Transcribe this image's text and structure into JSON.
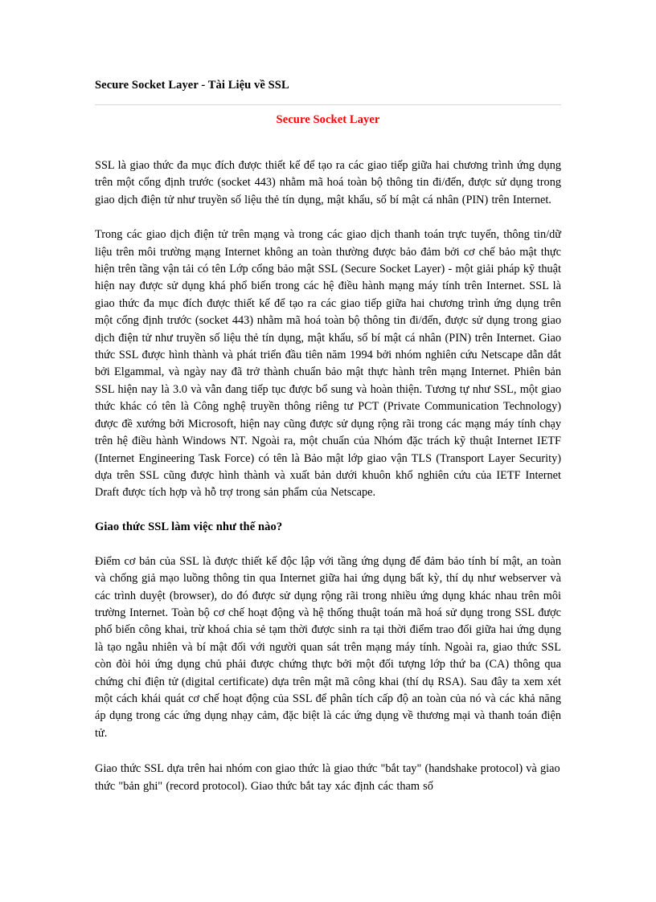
{
  "document": {
    "title": "Secure Socket Layer - Tài Liệu về SSL",
    "section_title": "Secure Socket Layer",
    "accent_color": "#ff0000",
    "text_color": "#000000",
    "rule_color": "#d9d9d9",
    "background_color": "#ffffff"
  },
  "body": {
    "paragraph_1": "SSL là giao thức đa mục đích được thiết kế để tạo ra các giao tiếp giữa hai chương trình ứng dụng trên một cổng định trước (socket 443) nhằm mã hoá toàn bộ thông tin đi/đến, được sử dụng trong giao dịch điện tử như truyền số liệu thẻ tín dụng, mật khẩu, số bí mật cá nhân (PIN) trên Internet.",
    "paragraph_2": "Trong các giao dịch điện tử trên mạng và trong các giao dịch thanh toán trực tuyến, thông tin/dữ liệu trên môi trường mạng Internet không an toàn thường được bảo đảm bởi cơ chế bảo mật thực hiện trên tầng vận tải có tên Lớp cổng bảo mật SSL (Secure Socket Layer) - một giải pháp kỹ thuật hiện nay được sử dụng khá phổ biến trong các hệ điều hành mạng máy tính trên Internet. SSL là giao thức đa mục đích được thiết kế để tạo ra các giao tiếp giữa hai chương trình ứng dụng trên một cổng định trước (socket 443) nhằm mã hoá toàn bộ thông tin đi/đến, được sử dụng trong giao dịch điện tử như truyền số liệu thẻ tín dụng, mật khẩu, số bí mật cá nhân (PIN) trên Internet. Giao thức SSL được hình thành và phát triển đầu tiên năm 1994 bởi nhóm nghiên cứu Netscape dẫn dắt bởi Elgammal, và ngày nay đã trở thành chuẩn bảo mật thực hành trên mạng Internet. Phiên bản SSL hiện nay là 3.0 và vẫn đang tiếp tục được bổ sung và hoàn thiện. Tương tự như SSL, một giao thức khác có tên là Công nghệ truyền thông riêng tư PCT (Private Communication Technology) được đề xướng bởi Microsoft, hiện nay cũng được sử dụng rộng rãi trong các mạng máy tính chạy trên hệ điều hành Windows NT. Ngoài ra, một chuẩn của Nhóm đặc trách kỹ thuật Internet IETF (Internet Engineering Task Force) có tên là Bảo mật lớp giao vận TLS (Transport Layer Security) dựa trên SSL cũng được hình thành và xuất bản dưới khuôn khổ nghiên cứu của IETF Internet Draft được tích hợp và hỗ trợ trong sản phẩm của Netscape.",
    "heading_1": "Giao thức SSL làm việc như thế nào?",
    "paragraph_3": "Điểm cơ bản của SSL là được thiết kế độc lập với tầng ứng dụng để đảm bảo tính bí mật, an toàn và chống giả mạo luồng thông tin qua Internet giữa hai ứng dụng bất kỳ, thí dụ như webserver và các trình duyệt (browser), do đó được sử dụng rộng rãi trong nhiều ứng dụng khác nhau trên môi trường Internet. Toàn bộ cơ chế hoạt động và hệ thống thuật toán mã hoá sử dụng trong SSL được phổ biến công khai, trừ khoá chia sẻ tạm thời được sinh ra tại thời điểm trao đổi giữa hai ứng dụng là tạo ngẫu nhiên và bí mật đối với người quan sát trên mạng máy tính. Ngoài ra, giao thức SSL còn đòi hỏi ứng dụng chủ phải được chứng thực bởi một đối tượng lớp thứ ba (CA) thông qua chứng chỉ điện tử (digital certificate) dựa trên mật mã công khai (thí dụ RSA). Sau đây ta xem xét một cách khái quát cơ chế hoạt động của SSL để phân tích cấp độ an toàn của nó và các khả năng áp dụng trong các ứng dụng nhạy cảm, đặc biệt là các ứng dụng về thương mại và thanh toán điện tử.",
    "paragraph_4": "Giao thức SSL dựa trên hai nhóm con giao thức là giao thức \"bắt tay\" (handshake protocol) và giao thức \"bản ghi\" (record protocol). Giao thức bắt tay xác định các tham số"
  }
}
